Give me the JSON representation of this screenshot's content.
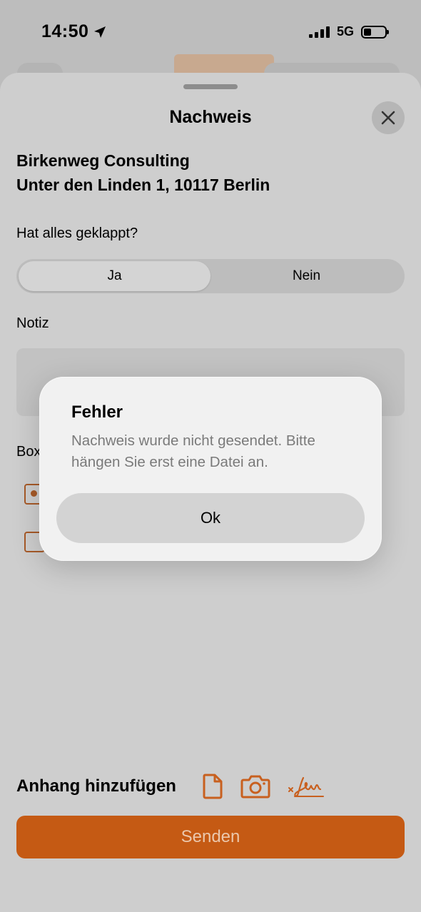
{
  "status_bar": {
    "time": "14:50",
    "network": "5G",
    "battery_level": 0.35
  },
  "sheet": {
    "title": "Nachweis",
    "company": "Birkenweg Consulting",
    "address": "Unter den Linden 1, 10117 Berlin",
    "question": "Hat alles geklappt?",
    "segment_options": [
      "Ja",
      "Nein"
    ],
    "selected_segment": "Ja",
    "note_label": "Notiz",
    "boxes_label": "Box",
    "attachment_label": "Anhang hinzufügen",
    "attachment_icons": [
      "document-icon",
      "camera-icon",
      "signature-icon"
    ],
    "send_label": "Senden"
  },
  "alert": {
    "title": "Fehler",
    "message": "Nachweis wurde nicht gesendet. Bitte hängen Sie erst eine Datei an.",
    "button_label": "Ok"
  },
  "colors": {
    "accent": "#c55a14",
    "icon_orange": "#c8601f"
  }
}
